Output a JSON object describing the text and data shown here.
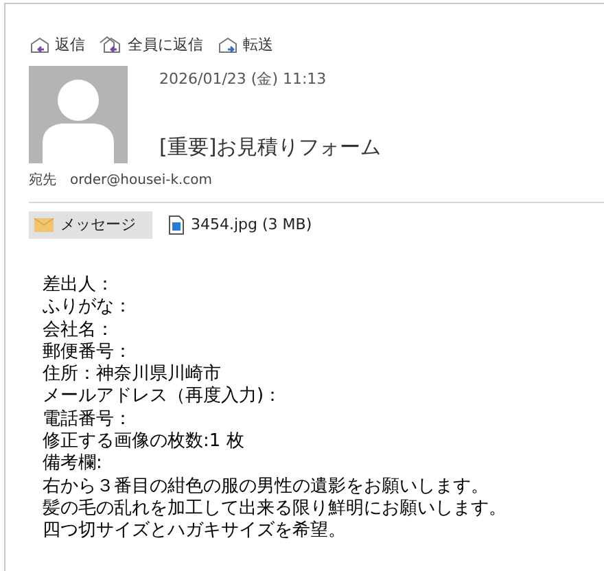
{
  "toolbar": [
    {
      "label": "返信",
      "kind": "reply"
    },
    {
      "label": "全員に返信",
      "kind": "reply_all"
    },
    {
      "label": "転送",
      "kind": "forward"
    }
  ],
  "message": {
    "date": "2026/01/23 (金) 11:13",
    "subject": "[重要]お見積りフォーム",
    "to_label": "宛先",
    "to": "order@housei-k.com"
  },
  "attachments": [
    {
      "label": "メッセージ",
      "kind": "message",
      "selected": true
    },
    {
      "label": "3454.jpg (3 MB)",
      "kind": "file",
      "selected": false
    }
  ],
  "body": [
    "差出人：",
    "ふりがな：",
    "会社名：",
    "郵便番号：",
    "住所：神奈川県川崎市",
    "メールアドレス（再度入力)：",
    "電話番号：",
    "修正する画像の枚数:1 枚",
    "備考欄:",
    "右から３番目の紺色の服の男性の遺影をお願いします。",
    "髪の毛の乱れを加工して出来る限り鮮明にお願いします。",
    "四つ切サイズとハガキサイズを希望。"
  ]
}
